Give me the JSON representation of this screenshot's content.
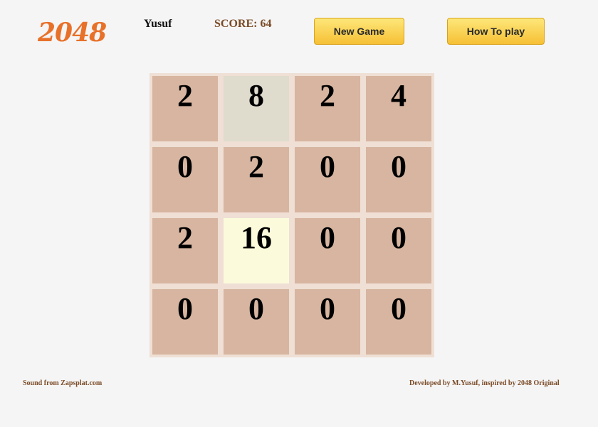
{
  "header": {
    "logo": "2048",
    "player_name": "Yusuf",
    "score_text": "SCORE: 64",
    "new_game_label": "New Game",
    "how_to_play_label": "How To play"
  },
  "board": {
    "rows": [
      [
        2,
        8,
        2,
        4
      ],
      [
        0,
        2,
        0,
        0
      ],
      [
        2,
        16,
        0,
        0
      ],
      [
        0,
        0,
        0,
        0
      ]
    ]
  },
  "colors": {
    "logo": "#e8712a",
    "board_bg": "#efdfd4",
    "tile_default": "#d7b5a0",
    "tile_8": "#dfdbcd",
    "tile_16": "#fbfbdb",
    "button_top": "#fde77a",
    "button_bottom": "#f6c035"
  },
  "footer": {
    "left": "Sound from Zapsplat.com",
    "right": "Developed by M.Yusuf, inspired by 2048 Original"
  }
}
